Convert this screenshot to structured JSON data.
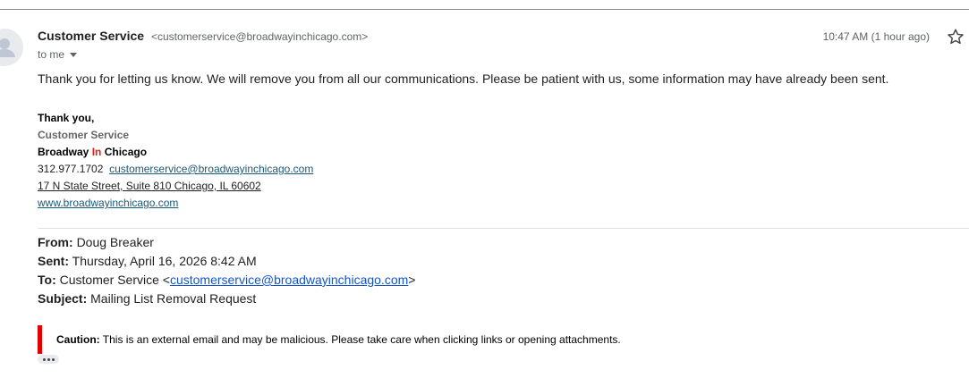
{
  "message": {
    "sender_name": "Customer Service",
    "sender_email": "<customerservice@broadwayinchicago.com>",
    "to_label": "to me",
    "timestamp": "10:47 AM (1 hour ago)",
    "body": "Thank you for letting us know. We will remove you from all our communications. Please be patient with us, some information may have already been sent."
  },
  "signature": {
    "thanks": "Thank you,",
    "dept": "Customer Service",
    "org_part1": "Broadway",
    "org_part2": "In",
    "org_part3": "Chicago",
    "phone": "312.977.1702",
    "email": "customerservice@broadwayinchicago.com",
    "address": "17 N State Street, Suite 810 Chicago, IL 60602",
    "website": "www.broadwayinchicago.com"
  },
  "quoted": {
    "from_label": "From:",
    "from_value": "Doug Breaker",
    "sent_label": "Sent:",
    "sent_value": "Thursday, April 16, 2026 8:42 AM",
    "to_label": "To:",
    "to_name": "Customer Service <",
    "to_email": "customerservice@broadwayinchicago.com",
    "to_close": ">",
    "subject_label": "Subject:",
    "subject_value": "Mailing List Removal Request"
  },
  "caution": {
    "label": "Caution:",
    "text": "This is an external email and may be malicious. Please take care when clicking links or opening attachments."
  },
  "colors": {
    "accent_red": "#e60000",
    "link_blue": "#1155cc",
    "signature_link": "#1a5a7a"
  },
  "icons": {
    "avatar": "person-icon",
    "star": "star-icon",
    "dropdown": "chevron-down-icon",
    "more": "ellipsis-icon"
  }
}
